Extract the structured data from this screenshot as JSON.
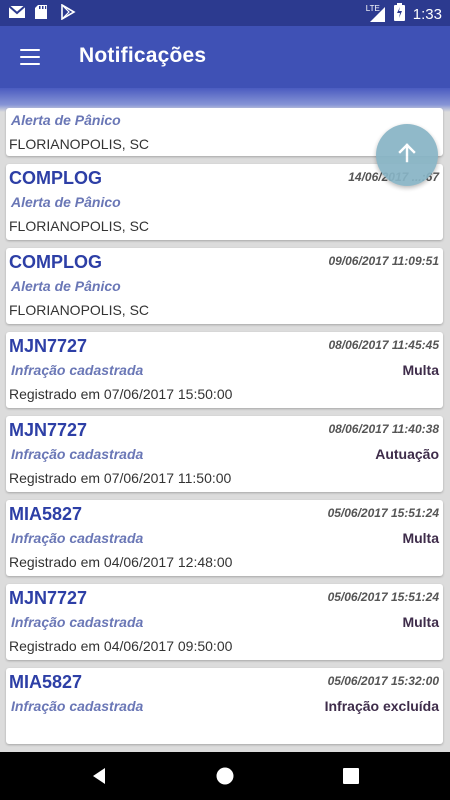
{
  "status_bar": {
    "icons": [
      "gmail-icon",
      "sd-card-icon",
      "play-store-icon"
    ],
    "network_label": "LTE",
    "time": "1:33"
  },
  "app_bar": {
    "title": "Notificações",
    "menu_icon": "hamburger-menu-icon"
  },
  "notifications": [
    {
      "title": "",
      "date": "",
      "subtitle": "Alerta de Pânico",
      "status": "",
      "detail": "FLORIANOPOLIS, SC"
    },
    {
      "title": "COMPLOG",
      "date": "14/06/2017 ...:67",
      "subtitle": "Alerta de Pânico",
      "status": "",
      "detail": "FLORIANOPOLIS, SC"
    },
    {
      "title": "COMPLOG",
      "date": "09/06/2017 11:09:51",
      "subtitle": "Alerta de Pânico",
      "status": "",
      "detail": "FLORIANOPOLIS, SC"
    },
    {
      "title": "MJN7727",
      "date": "08/06/2017 11:45:45",
      "subtitle": "Infração cadastrada",
      "status": "Multa",
      "detail": "Registrado em 07/06/2017 15:50:00"
    },
    {
      "title": "MJN7727",
      "date": "08/06/2017 11:40:38",
      "subtitle": "Infração cadastrada",
      "status": "Autuação",
      "detail": "Registrado em 07/06/2017 11:50:00"
    },
    {
      "title": "MIA5827",
      "date": "05/06/2017 15:51:24",
      "subtitle": "Infração cadastrada",
      "status": "Multa",
      "detail": "Registrado em 04/06/2017 12:48:00"
    },
    {
      "title": "MJN7727",
      "date": "05/06/2017 15:51:24",
      "subtitle": "Infração cadastrada",
      "status": "Multa",
      "detail": "Registrado em 04/06/2017 09:50:00"
    },
    {
      "title": "MIA5827",
      "date": "05/06/2017 15:32:00",
      "subtitle": "Infração cadastrada",
      "status": "Infração excluída",
      "detail": ""
    }
  ],
  "fab": {
    "icon": "arrow-up-icon"
  },
  "nav_bar": {
    "icons": [
      "back-icon",
      "home-icon",
      "recents-icon"
    ]
  },
  "colors": {
    "primary": "#3f51b5",
    "primary_dark": "#2c3a8f",
    "title_text": "#2d3fa6",
    "subtitle_text": "#6a77b6",
    "fab": "#87b4c5"
  }
}
